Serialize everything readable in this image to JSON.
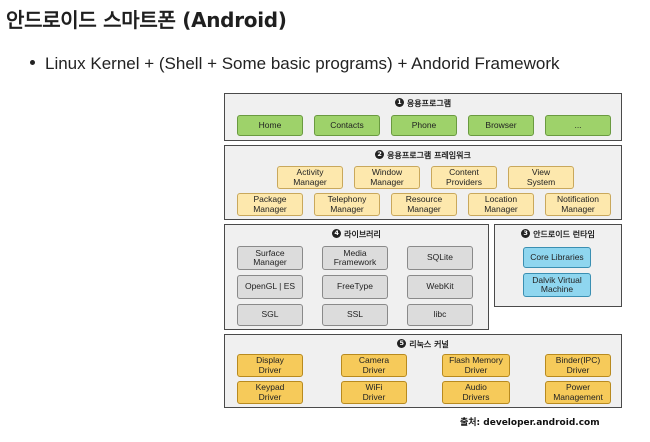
{
  "heading": "안드로이드 스마트폰 (Android)",
  "bullet": "Linux Kernel + (Shell + Some basic programs) + Andorid Framework",
  "diagram": {
    "applications": {
      "number": "1",
      "title": "응용프로그램",
      "items": [
        "Home",
        "Contacts",
        "Phone",
        "Browser",
        "..."
      ]
    },
    "framework": {
      "number": "2",
      "title": "응용프로그램 프레임워크",
      "row1": [
        "Activity\nManager",
        "Window\nManager",
        "Content\nProviders",
        "View\nSystem"
      ],
      "row2": [
        "Package\nManager",
        "Telephony\nManager",
        "Resource\nManager",
        "Location\nManager",
        "Notification\nManager"
      ]
    },
    "libraries": {
      "number": "4",
      "title": "라이브러리",
      "items": [
        "Surface\nManager",
        "Media\nFramework",
        "SQLite",
        "OpenGL | ES",
        "FreeType",
        "WebKit",
        "SGL",
        "SSL",
        "libc"
      ]
    },
    "runtime": {
      "number": "3",
      "title": "안드로이드 런타임",
      "items": [
        "Core Libraries",
        "Dalvik Virtual\nMachine"
      ]
    },
    "kernel": {
      "number": "5",
      "title": "리눅스 커널",
      "items": [
        "Display\nDriver",
        "Camera\nDriver",
        "Flash Memory\nDriver",
        "Binder(IPC)\nDriver",
        "Keypad\nDriver",
        "WiFi\nDriver",
        "Audio\nDrivers",
        "Power\nManagement"
      ]
    }
  },
  "source": "출처: developer.android.com",
  "colors": {
    "app_green": "#9ed26a",
    "framework_yellow": "#fde8ad",
    "library_grey": "#dcdcdc",
    "runtime_blue": "#8fd6ef",
    "kernel_orange": "#f6ca5a"
  }
}
